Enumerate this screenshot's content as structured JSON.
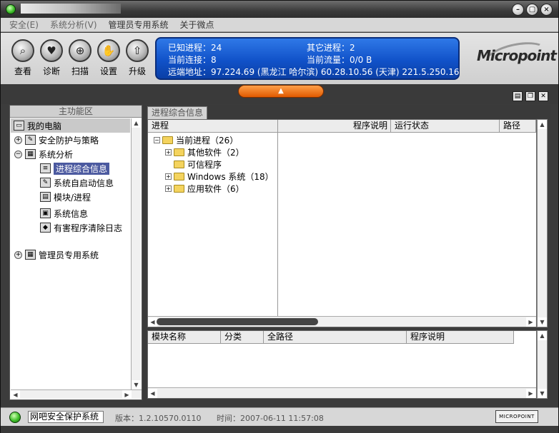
{
  "window": {
    "title_led": "app-status-led"
  },
  "menu": {
    "items": [
      "安全(E)",
      "系统分析(V)",
      "管理员专用系统",
      "关于微点"
    ]
  },
  "toolbar": {
    "buttons": [
      {
        "label": "查看",
        "icon": "magnifier-icon"
      },
      {
        "label": "诊断",
        "icon": "heart-monitor-icon"
      },
      {
        "label": "扫描",
        "icon": "scan-icon"
      },
      {
        "label": "设置",
        "icon": "settings-icon"
      },
      {
        "label": "升级",
        "icon": "upgrade-icon"
      }
    ]
  },
  "info": {
    "known_proc": "已知进程：24",
    "other_proc": "其它进程：2",
    "current_conn": "当前连接：8",
    "current_traffic": "当前流量：0/0 B",
    "remote_addr": "远端地址：97.224.69 (黑龙江 哈尔滨)   60.28.10.56 (天津)   221.5.250.16"
  },
  "brand": {
    "logo_text": "Micropoint"
  },
  "left_panel": {
    "title": "主功能区",
    "root": "我的电脑",
    "items": [
      {
        "label": "安全防护与策略"
      },
      {
        "label": "系统分析"
      },
      {
        "label": "进程综合信息"
      },
      {
        "label": "系统自启动信息"
      },
      {
        "label": "模块/进程"
      },
      {
        "label": "系统信息"
      },
      {
        "label": "有害程序清除日志"
      },
      {
        "label": "管理员专用系统"
      }
    ]
  },
  "tab": {
    "label": "进程综合信息"
  },
  "proc_table": {
    "columns": [
      "进程",
      "程序说明",
      "运行状态",
      "路径"
    ],
    "tree": [
      {
        "label": "当前进程（26）"
      },
      {
        "label": "其他软件（2）"
      },
      {
        "label": "可信程序"
      },
      {
        "label": "Windows 系统（18）"
      },
      {
        "label": "应用软件（6）"
      }
    ]
  },
  "module_table": {
    "columns": [
      "模块名称",
      "分类",
      "全路径",
      "程序说明"
    ]
  },
  "status": {
    "name": "网吧安全保护系统",
    "version": "版本：1.2.10570.0110",
    "time": "时间：2007-06-11 11:57:08",
    "logo": "MICROPOINT"
  }
}
